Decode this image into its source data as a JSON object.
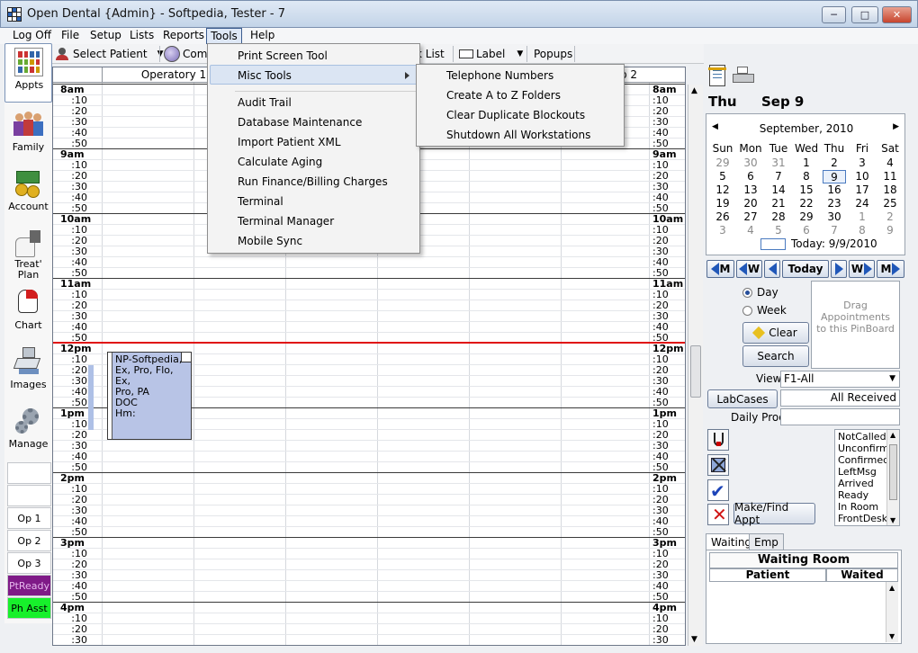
{
  "window": {
    "title": "Open Dental {Admin} - Softpedia, Tester - 7",
    "minimize": "─",
    "maximize": "□",
    "close": "✕"
  },
  "menubar": {
    "items": [
      "Log Off",
      "File",
      "Setup",
      "Lists",
      "Reports",
      "Tools",
      "Help"
    ]
  },
  "toolbar": {
    "select_patient": "Select Patient",
    "commlog": "Com",
    "list": "k List",
    "label": "Label",
    "popups": "Popups"
  },
  "tools_menu": {
    "items": [
      "Print Screen Tool",
      "Misc Tools",
      "Audit Trail",
      "Database Maintenance",
      "Import Patient XML",
      "Calculate Aging",
      "Run Finance/Billing Charges",
      "Terminal",
      "Terminal Manager",
      "Mobile Sync"
    ]
  },
  "misc_submenu": {
    "items": [
      "Telephone Numbers",
      "Create A to Z Folders",
      "Clear Duplicate Blockouts",
      "Shutdown All Workstations"
    ]
  },
  "modules": [
    {
      "label": "Appts",
      "icon": "appointments-icon"
    },
    {
      "label": "Family",
      "icon": "family-icon"
    },
    {
      "label": "Account",
      "icon": "account-icon"
    },
    {
      "label": "Treat' Plan",
      "icon": "treatment-plan-icon"
    },
    {
      "label": "Chart",
      "icon": "chart-icon"
    },
    {
      "label": "Images",
      "icon": "images-icon"
    },
    {
      "label": "Manage",
      "icon": "manage-icon"
    }
  ],
  "op_buttons": [
    "",
    "",
    "Op 1",
    "Op 2",
    "Op 3",
    "PtReady",
    "Ph Asst"
  ],
  "colors": {
    "ptready": "#7f1a87",
    "phasst": "#17f02b",
    "appt": "#b8c4e6",
    "now_line": "#e01010"
  },
  "operatories": [
    "Operatory 1",
    "p 2"
  ],
  "hours": [
    "8am",
    "9am",
    "10am",
    "11am",
    "12pm",
    "1pm",
    "2pm",
    "3pm",
    "4pm"
  ],
  "minutes": [
    ":10",
    ":20",
    ":30",
    ":40",
    ":50"
  ],
  "appointment": {
    "lines": [
      "NP-Softpedia,",
      "Ex, Pro, Flo, Ex,",
      "Pro, PA",
      "DOC",
      "Hm:"
    ]
  },
  "date": {
    "weekday": "Thu",
    "month_day": "Sep 9"
  },
  "calendar": {
    "month": "September, 2010",
    "days_of_week": [
      "Sun",
      "Mon",
      "Tue",
      "Wed",
      "Thu",
      "Fri",
      "Sat"
    ],
    "weeks": [
      [
        "29",
        "30",
        "31",
        "1",
        "2",
        "3",
        "4"
      ],
      [
        "5",
        "6",
        "7",
        "8",
        "9",
        "10",
        "11"
      ],
      [
        "12",
        "13",
        "14",
        "15",
        "16",
        "17",
        "18"
      ],
      [
        "19",
        "20",
        "21",
        "22",
        "23",
        "24",
        "25"
      ],
      [
        "26",
        "27",
        "28",
        "29",
        "30",
        "1",
        "2"
      ],
      [
        "3",
        "4",
        "5",
        "6",
        "7",
        "8",
        "9"
      ]
    ],
    "today_label": "Today: 9/9/2010"
  },
  "nav": {
    "month_left": "M",
    "week_left": "W",
    "today": "Today",
    "week_right": "W",
    "month_right": "M"
  },
  "view_mode": {
    "day": "Day",
    "week": "Week"
  },
  "pinboard": {
    "text": "Drag Appointments to this PinBoard"
  },
  "buttons": {
    "clear": "Clear",
    "search": "Search",
    "labcases": "LabCases",
    "make_find": "Make/Find Appt"
  },
  "view": {
    "label": "View",
    "value": "F1-All"
  },
  "labcases_status": "All Received",
  "daily_prod": {
    "label": "Daily Prod",
    "value": ""
  },
  "confirm_list": [
    "NotCalled",
    "Unconfirme",
    "Confirmed",
    "LeftMsg",
    "Arrived",
    "Ready",
    "In Room",
    "FrontDesk"
  ],
  "waiting": {
    "tabs": [
      "Waiting",
      "Emp"
    ],
    "title": "Waiting Room",
    "columns": [
      "Patient",
      "Waited"
    ]
  }
}
